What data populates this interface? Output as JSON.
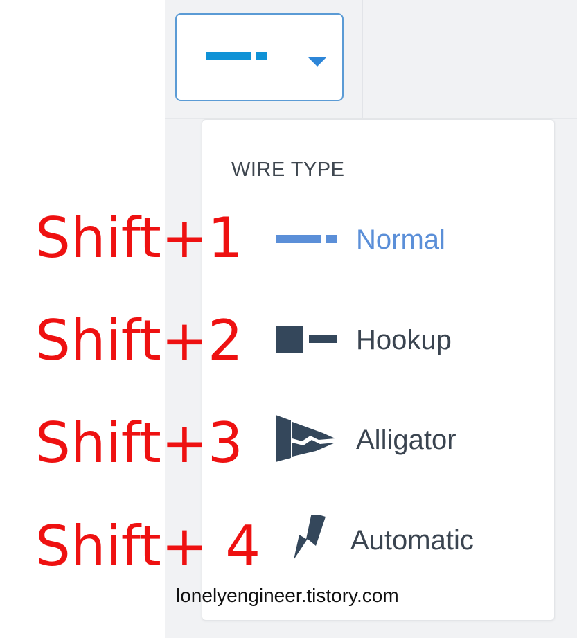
{
  "colors": {
    "accent": "#5b9bd5",
    "selected_text": "#5b8fd8",
    "normal_wire": "#0f92d6",
    "icon_dark": "#34475b",
    "annotation": "#ee1111"
  },
  "wire_selector": {
    "current_icon": "normal-wire-icon",
    "caret_icon": "caret-down-icon"
  },
  "menu": {
    "heading": "WIRE TYPE",
    "items": [
      {
        "label": "Normal",
        "icon": "normal-wire-icon",
        "selected": true
      },
      {
        "label": "Hookup",
        "icon": "hookup-wire-icon",
        "selected": false
      },
      {
        "label": "Alligator",
        "icon": "alligator-clip-icon",
        "selected": false
      },
      {
        "label": "Automatic",
        "icon": "lightning-bolt-icon",
        "selected": false
      }
    ]
  },
  "shortcuts": [
    "Shift+1",
    "Shift+2",
    "Shift+3",
    "Shift+ 4"
  ],
  "watermark": "lonelyengineer.tistory.com"
}
